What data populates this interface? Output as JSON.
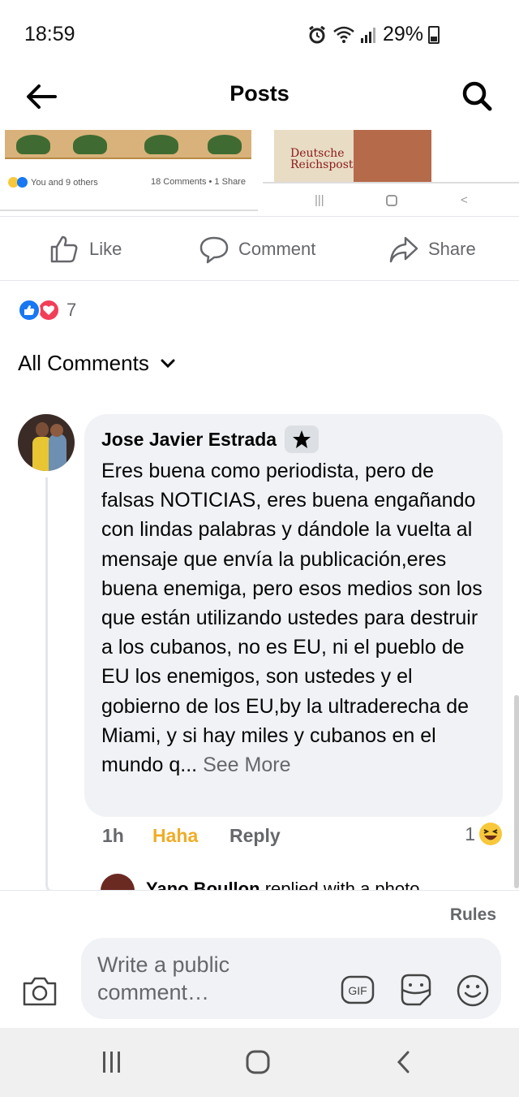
{
  "status_bar": {
    "time": "18:59",
    "battery": "29%",
    "icons": [
      "alarm-icon",
      "wifi-icon",
      "signal-icon",
      "battery-icon"
    ]
  },
  "header": {
    "title": "Posts",
    "back_icon": "back-arrow-icon",
    "search_icon": "search-icon"
  },
  "shared_preview": {
    "reactions_text": "You and 9 others",
    "counts_text": "18 Comments • 1 Share",
    "poster_text_line1": "Deutsche",
    "poster_text_line2": "Reichspost"
  },
  "actions": {
    "like_label": "Like",
    "comment_label": "Comment",
    "share_label": "Share"
  },
  "reactions": {
    "count": "7",
    "types": [
      "like",
      "love"
    ]
  },
  "comments_filter": {
    "label": "All Comments"
  },
  "comment": {
    "author": "Jose Javier Estrada",
    "text": "Eres buena como periodista, pero de falsas NOTICIAS, eres buena engañando con lindas palabras y dándole la vuelta al mensaje que envía la publicación,eres buena enemiga, pero esos medios son los que están utilizando ustedes para destruir a los cubanos, no es EU, ni el pueblo de EU los enemigos, son ustedes y el gobierno de los EU,by la ultraderecha de Miami, y si hay miles y cubanos en el mundo q...",
    "see_more": "See More",
    "time": "1h",
    "reaction_label": "Haha",
    "reply_label": "Reply",
    "reaction_count": "1"
  },
  "reply_preview": {
    "name": "Yano Boullon",
    "action": "replied with a photo"
  },
  "composer": {
    "rules_label": "Rules",
    "placeholder": "Write a public comment…"
  },
  "colors": {
    "accent_blue": "#1877f2",
    "love_red": "#f33e58",
    "haha_yellow": "#f0ac26",
    "secondary_text": "#65676b",
    "bubble_bg": "#f0f2f5"
  }
}
